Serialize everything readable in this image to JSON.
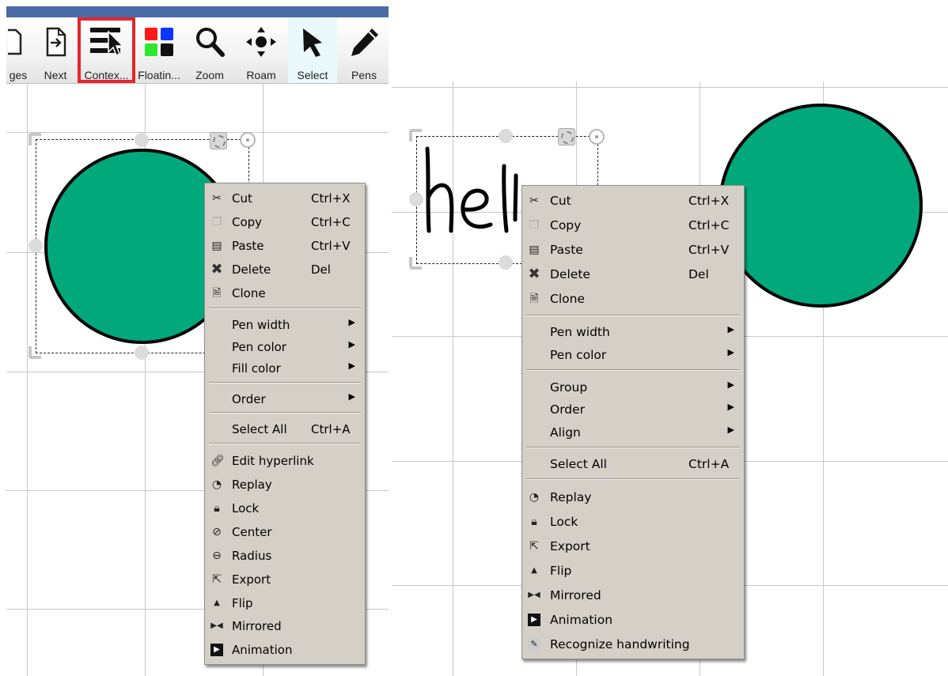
{
  "toolbar": {
    "tools": [
      {
        "label": "ges",
        "icon": "pages-icon"
      },
      {
        "label": "Next",
        "icon": "next-page-icon"
      },
      {
        "label": "Contex...",
        "icon": "context-menu-icon",
        "highlighted": true
      },
      {
        "label": "Floatin...",
        "icon": "floating-palette-icon"
      },
      {
        "label": "Zoom",
        "icon": "zoom-icon"
      },
      {
        "label": "Roam",
        "icon": "roam-icon"
      },
      {
        "label": "Select",
        "icon": "select-arrow-icon",
        "selected": true
      },
      {
        "label": "Pens",
        "icon": "pen-icon"
      }
    ],
    "highlight_color": "#e3262b"
  },
  "left_canvas": {
    "shape": {
      "type": "circle",
      "fill": "#00a87b",
      "stroke": "#000000"
    }
  },
  "right_canvas": {
    "handwriting": "hell",
    "shape": {
      "type": "circle",
      "fill": "#00a87b",
      "stroke": "#000000"
    }
  },
  "left_menu": {
    "items": [
      {
        "label": "Cut",
        "shortcut": "Ctrl+X",
        "icon": "scissors-icon"
      },
      {
        "label": "Copy",
        "shortcut": "Ctrl+C",
        "icon": "copy-icon"
      },
      {
        "label": "Paste",
        "shortcut": "Ctrl+V",
        "icon": "paste-icon"
      },
      {
        "label": "Delete",
        "shortcut": "Del",
        "icon": "delete-icon"
      },
      {
        "label": "Clone",
        "shortcut": "",
        "icon": "clone-icon"
      },
      {
        "label": "Pen width",
        "submenu": true
      },
      {
        "label": "Pen color",
        "submenu": true
      },
      {
        "label": "Fill color",
        "submenu": true
      },
      {
        "label": "Order",
        "submenu": true
      },
      {
        "label": "Select All",
        "shortcut": "Ctrl+A"
      },
      {
        "label": "Edit hyperlink",
        "icon": "link-icon"
      },
      {
        "label": "Replay",
        "icon": "replay-icon"
      },
      {
        "label": "Lock",
        "icon": "lock-icon"
      },
      {
        "label": "Center",
        "icon": "center-icon"
      },
      {
        "label": "Radius",
        "icon": "radius-icon"
      },
      {
        "label": "Export",
        "icon": "export-icon"
      },
      {
        "label": "Flip",
        "icon": "flip-icon"
      },
      {
        "label": "Mirrored",
        "icon": "mirrored-icon"
      },
      {
        "label": "Animation",
        "icon": "animation-icon"
      }
    ]
  },
  "right_menu": {
    "items": [
      {
        "label": "Cut",
        "shortcut": "Ctrl+X",
        "icon": "scissors-icon"
      },
      {
        "label": "Copy",
        "shortcut": "Ctrl+C",
        "icon": "copy-icon"
      },
      {
        "label": "Paste",
        "shortcut": "Ctrl+V",
        "icon": "paste-icon"
      },
      {
        "label": "Delete",
        "shortcut": "Del",
        "icon": "delete-icon"
      },
      {
        "label": "Clone",
        "shortcut": "",
        "icon": "clone-icon"
      },
      {
        "label": "Pen width",
        "submenu": true
      },
      {
        "label": "Pen color",
        "submenu": true
      },
      {
        "label": "Group",
        "submenu": true
      },
      {
        "label": "Order",
        "submenu": true
      },
      {
        "label": "Align",
        "submenu": true
      },
      {
        "label": "Select All",
        "shortcut": "Ctrl+A"
      },
      {
        "label": "Replay",
        "icon": "replay-icon"
      },
      {
        "label": "Lock",
        "icon": "lock-icon"
      },
      {
        "label": "Export",
        "icon": "export-icon"
      },
      {
        "label": "Flip",
        "icon": "flip-icon"
      },
      {
        "label": "Mirrored",
        "icon": "mirrored-icon"
      },
      {
        "label": "Animation",
        "icon": "animation-icon"
      },
      {
        "label": "Recognize handwriting",
        "icon": "recognize-handwriting-icon"
      }
    ]
  }
}
